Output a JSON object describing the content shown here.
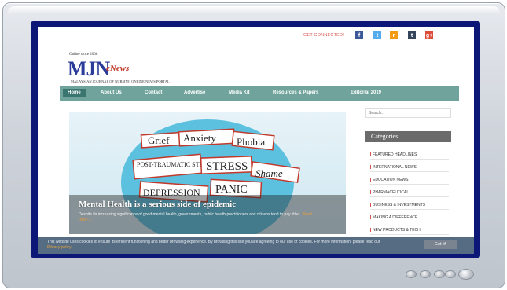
{
  "header": {
    "connect_label": "GET CONNECTED!",
    "since": "Online since 2008",
    "logo_main": "MJN",
    "logo_sub": "eNews",
    "tagline": "MALAYSIAN JOURNAL OF NURSING ONLINE NEWS PORTAL",
    "social": [
      {
        "icon": "facebook-icon",
        "glyph": "f",
        "color": "#3b5998"
      },
      {
        "icon": "twitter-icon",
        "glyph": "t",
        "color": "#55acee"
      },
      {
        "icon": "rss-icon",
        "glyph": "r",
        "color": "#f39c12"
      },
      {
        "icon": "tumblr-icon",
        "glyph": "t",
        "color": "#35465c"
      },
      {
        "icon": "google-plus-icon",
        "glyph": "g+",
        "color": "#dd4b39"
      }
    ]
  },
  "nav": {
    "items": [
      "Home",
      "About Us",
      "Contact",
      "Advertise",
      "Media Kit",
      "Resources & Papers",
      "Editorial 2019"
    ]
  },
  "hero": {
    "title": "Mental Health is a serious side of epidemic",
    "description": "Despite its increasing significance of good mental health, governments, public health practitioners and citizens tend to pay little...",
    "read_more": "Read more ›",
    "words": [
      "Grief",
      "Anxiety",
      "Phobia",
      "POST-TRAUMATIC STRESS",
      "STRESS",
      "Shame",
      "DEPRESSION",
      "PANIC"
    ]
  },
  "sidebar": {
    "search_placeholder": "Search...",
    "categories_title": "Categories",
    "categories": [
      "FEATURED HEADLINES",
      "INTERNATIONAL NEWS",
      "EDUCATION NEWS",
      "PHARMACEUTICAL",
      "BUSINESS & INVESTMENTS",
      "MAKING A DIFFERENCE",
      "NEW PRODUCTS & TECH"
    ]
  },
  "cookie": {
    "text": "This website uses cookies to ensure its efficient functioning and better browsing experience. By browsing this site you are agreeing to our use of cookies. For more information, please read our",
    "policy_link": "Privacy policy",
    "button": "Got it!"
  },
  "colors": {
    "screen_border": "#0c1777",
    "nav": "#6fa39c",
    "accent": "#d9534f"
  }
}
